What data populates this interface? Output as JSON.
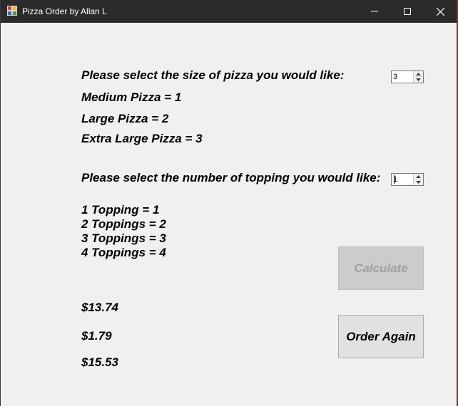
{
  "window": {
    "title": "Pizza Order by Allan L",
    "icon": "app-icon",
    "controls": [
      "minimize-icon",
      "maximize-icon",
      "close-icon"
    ]
  },
  "size": {
    "prompt": "Please select the size of pizza you would like:",
    "value": "3",
    "options": [
      "Medium Pizza = 1",
      "Large Pizza = 2",
      "Extra Large Pizza = 3"
    ]
  },
  "toppings": {
    "prompt": "Please select the number of topping you would like:",
    "value": "1",
    "options": [
      "1 Topping = 1",
      "2 Toppings = 2",
      "3 Toppings = 3",
      "4 Toppings = 4"
    ]
  },
  "results": {
    "subtotal": "$13.74",
    "tax": "$1.79",
    "total": "$15.53"
  },
  "buttons": {
    "calculate": "Calculate",
    "order_again": "Order Again"
  }
}
